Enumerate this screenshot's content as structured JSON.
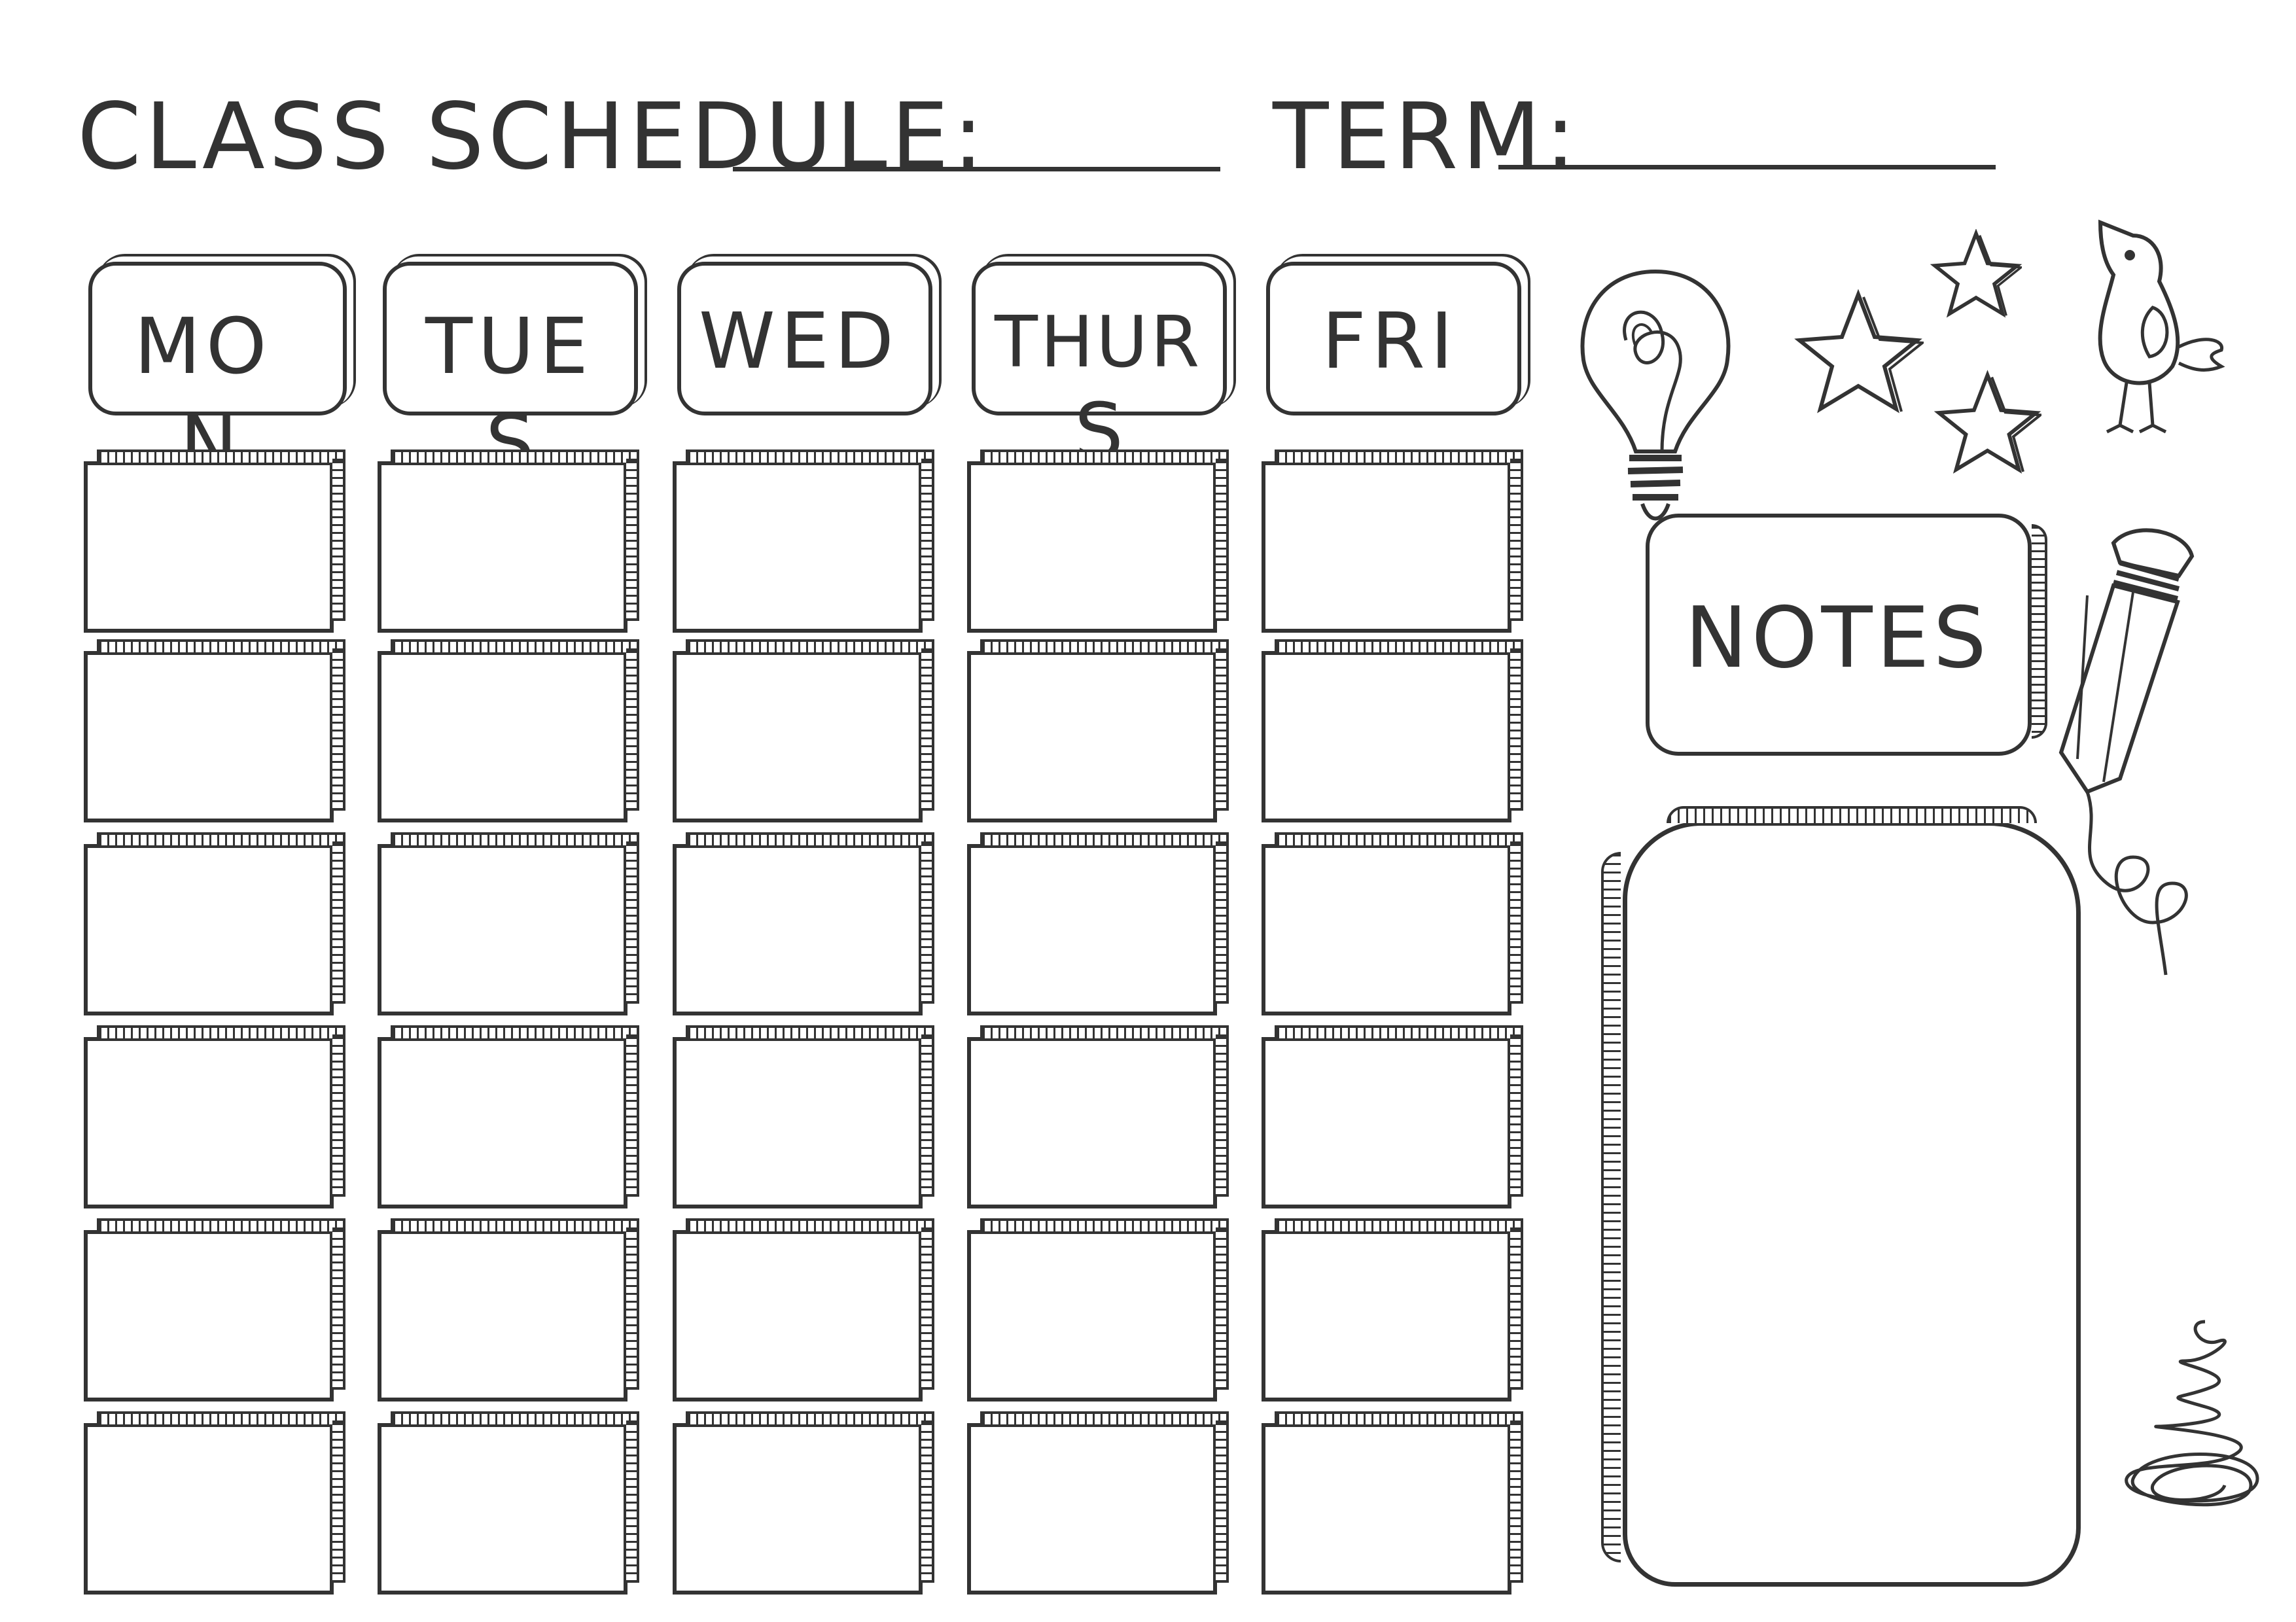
{
  "header": {
    "title": "CLASS SCHEDULE:",
    "term_label": "TERM:"
  },
  "days": [
    {
      "line1": "MO",
      "line2": "N"
    },
    {
      "line1": "TUE",
      "line2": "S"
    },
    {
      "line1": "WED",
      "line2": ""
    },
    {
      "line1": "THUR",
      "line2": "S"
    },
    {
      "line1": "FRI",
      "line2": ""
    }
  ],
  "grid": {
    "rows": 6,
    "columns": 5
  },
  "notes": {
    "label": "NOTES"
  },
  "icons": [
    "lightbulb-icon",
    "star-icon",
    "bird-icon",
    "pencil-icon",
    "scribble-icon"
  ],
  "colors": {
    "ink": "#333333",
    "paper": "#ffffff"
  }
}
